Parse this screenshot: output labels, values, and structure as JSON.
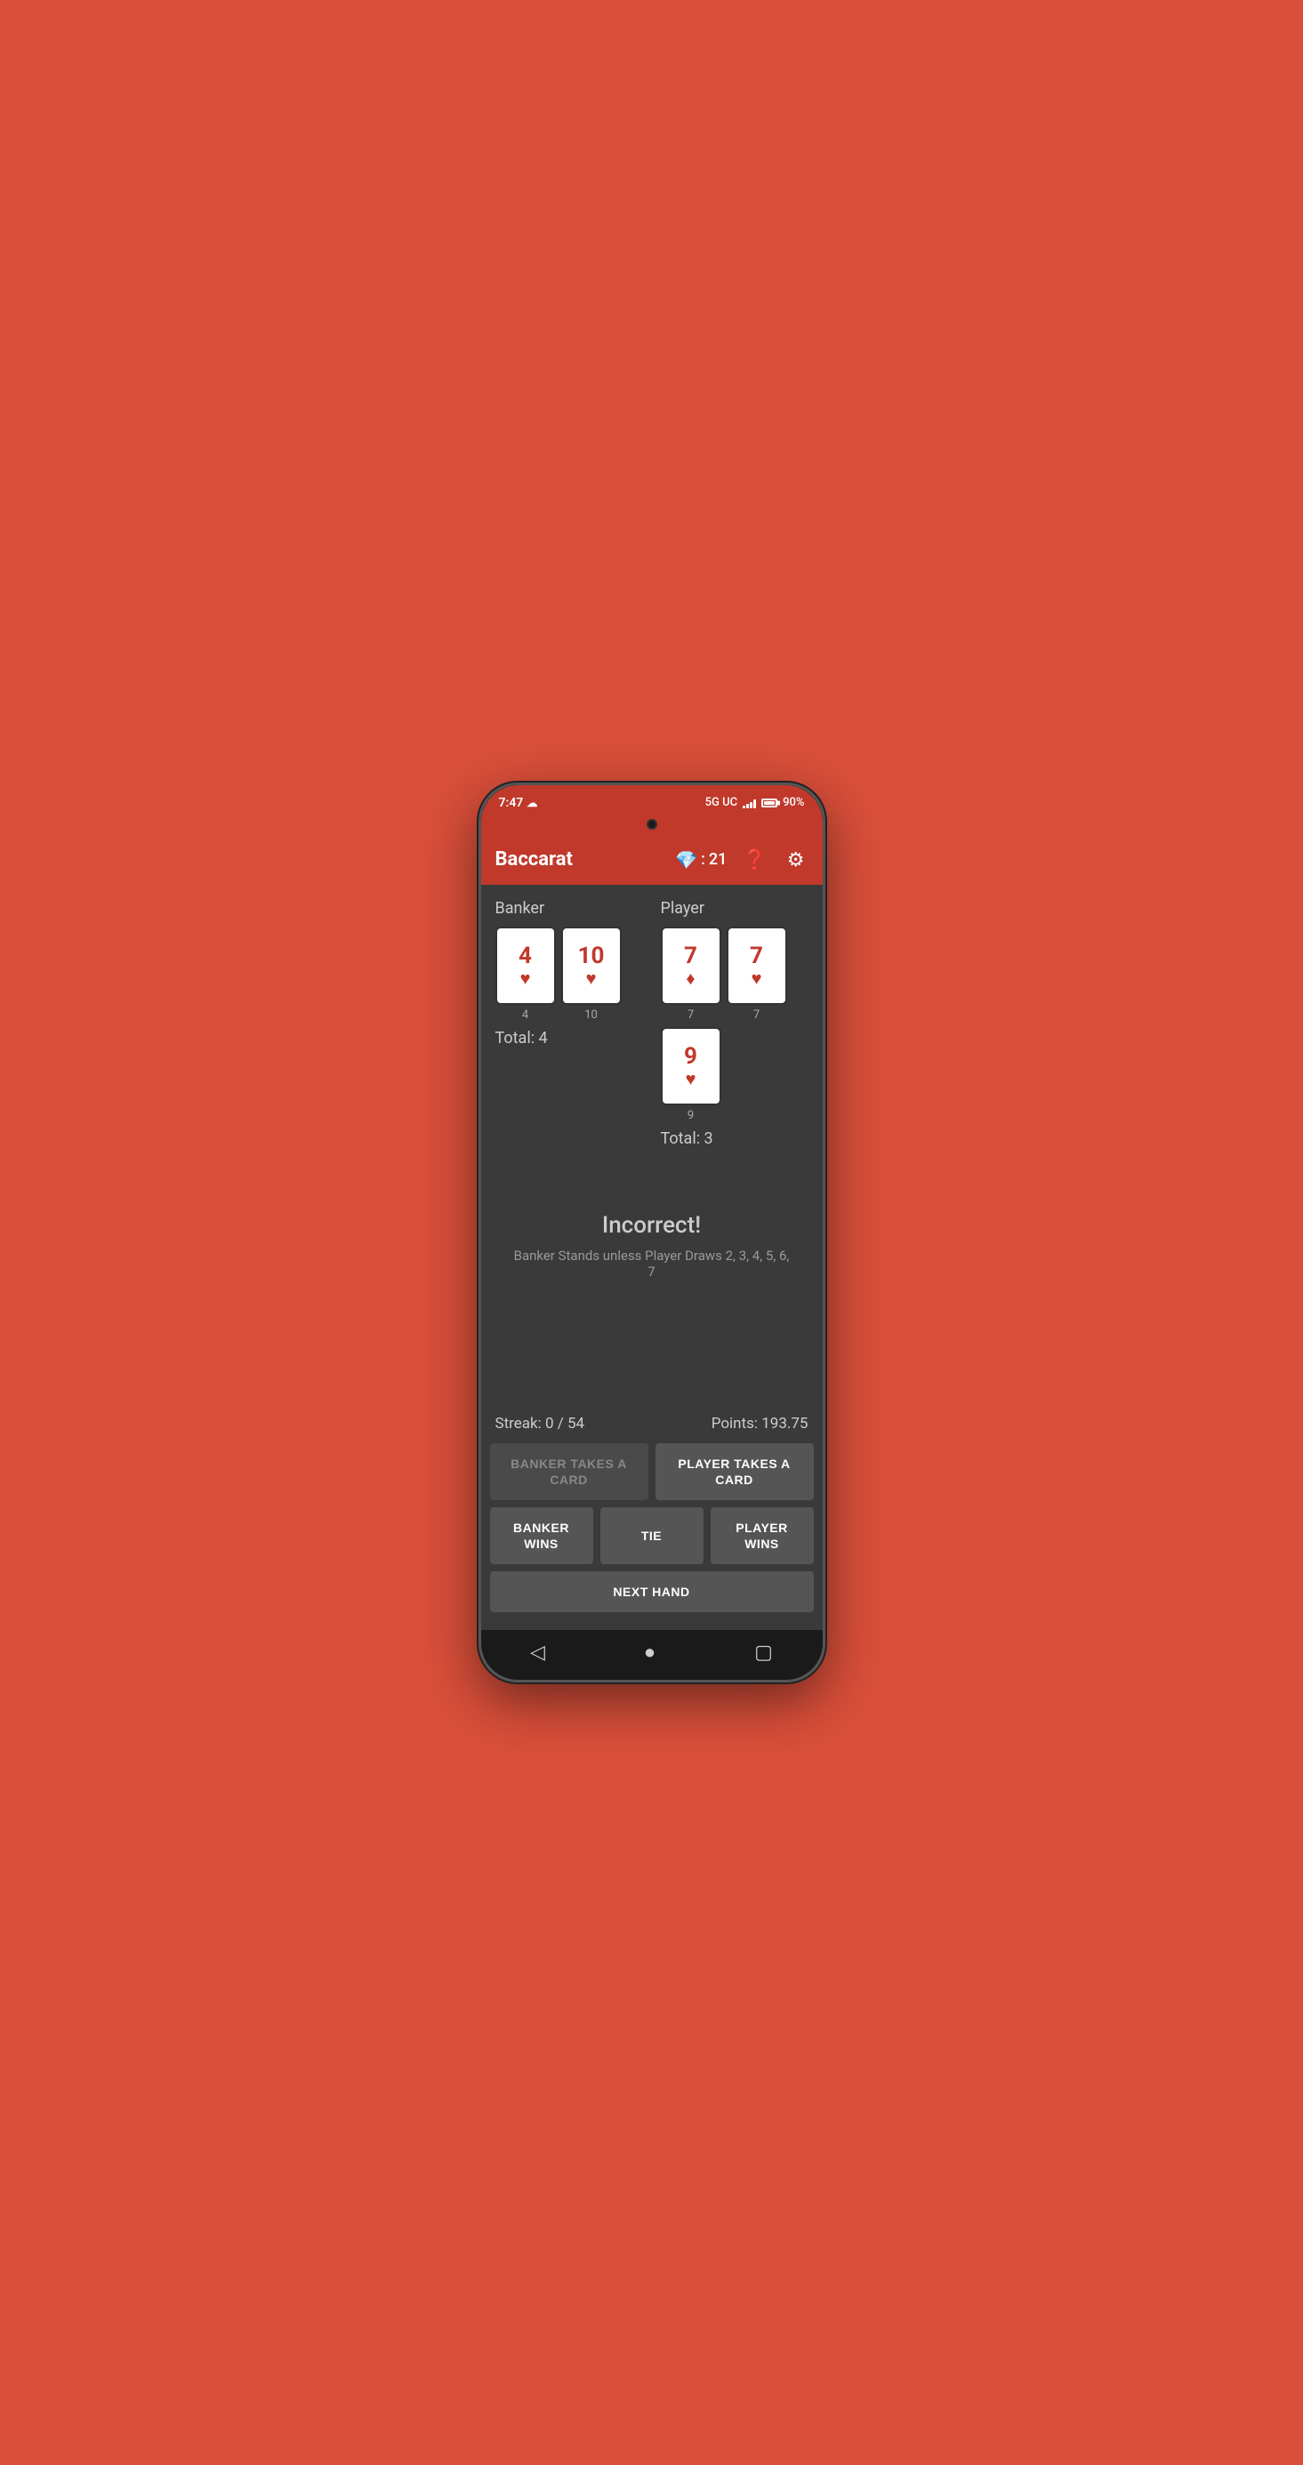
{
  "status_bar": {
    "time": "7:47",
    "network": "5G UC",
    "battery": "90%"
  },
  "app_bar": {
    "title": "Baccarat",
    "gem_score": "21",
    "help_label": "help",
    "settings_label": "settings"
  },
  "banker": {
    "label": "Banker",
    "cards": [
      {
        "value": "4",
        "suit": "♥",
        "suit_type": "heart",
        "number": "4"
      },
      {
        "value": "10",
        "suit": "♥",
        "suit_type": "heart",
        "number": "10"
      }
    ],
    "total_label": "Total: 4"
  },
  "player": {
    "label": "Player",
    "cards": [
      {
        "value": "7",
        "suit": "♦",
        "suit_type": "diamond",
        "number": "7"
      },
      {
        "value": "7",
        "suit": "♥",
        "suit_type": "heart",
        "number": "7"
      },
      {
        "value": "9",
        "suit": "♥",
        "suit_type": "heart",
        "number": "9"
      }
    ],
    "total_label": "Total: 3"
  },
  "result": {
    "title": "Incorrect!",
    "subtitle": "Banker Stands unless Player Draws 2, 3, 4, 5, 6, 7"
  },
  "stats": {
    "streak": "Streak: 0 / 54",
    "points": "Points: 193.75"
  },
  "buttons": {
    "banker_takes_card": "BANKER TAKES A CARD",
    "player_takes_card": "PLAYER TAKES A CARD",
    "banker_wins": "BANKER WINS",
    "tie": "TIE",
    "player_wins": "PLAYER WINS",
    "next_hand": "NEXT HAND"
  }
}
